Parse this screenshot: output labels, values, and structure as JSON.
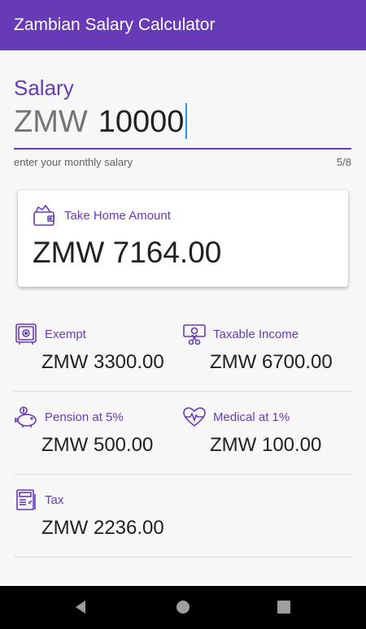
{
  "app": {
    "title": "Zambian Salary Calculator"
  },
  "salary_field": {
    "label": "Salary",
    "prefix": "ZMW",
    "value": "10000",
    "helper": "enter your monthly salary",
    "counter": "5/8"
  },
  "take_home": {
    "title": "Take Home Amount",
    "value": "ZMW 7164.00",
    "icon": "wallet-icon"
  },
  "breakdown": [
    {
      "title": "Exempt",
      "value": "ZMW 3300.00",
      "icon": "safe-icon"
    },
    {
      "title": "Taxable Income",
      "value": "ZMW 6700.00",
      "icon": "money-cut-icon"
    },
    {
      "title": "Pension at 5%",
      "value": "ZMW 500.00",
      "icon": "piggy-bank-icon"
    },
    {
      "title": "Medical at 1%",
      "value": "ZMW 100.00",
      "icon": "heartbeat-icon"
    },
    {
      "title": "Tax",
      "value": "ZMW 2236.00",
      "icon": "tax-document-icon"
    }
  ],
  "nav": {
    "back": "back-icon",
    "home": "home-icon",
    "recents": "recents-icon"
  },
  "colors": {
    "accent": "#673ab7",
    "caret": "#2196f3"
  }
}
